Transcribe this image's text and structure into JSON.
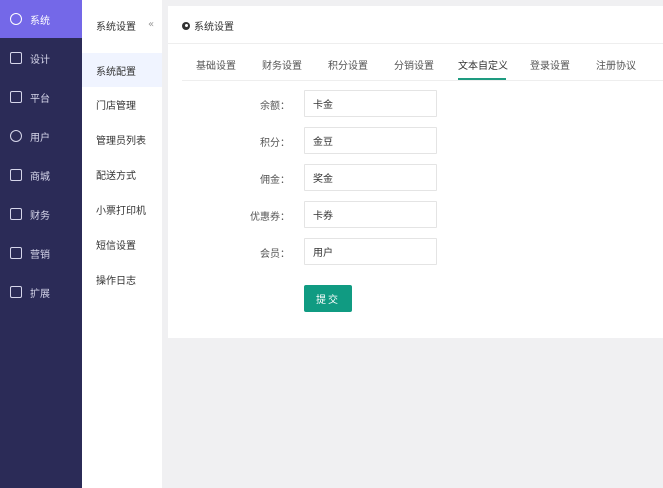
{
  "nav": {
    "items": [
      {
        "label": "系统",
        "icon": "settings-icon"
      },
      {
        "label": "设计",
        "icon": "monitor-icon"
      },
      {
        "label": "平台",
        "icon": "monitor-icon"
      },
      {
        "label": "用户",
        "icon": "user-icon"
      },
      {
        "label": "商城",
        "icon": "shop-icon"
      },
      {
        "label": "财务",
        "icon": "finance-icon"
      },
      {
        "label": "营销",
        "icon": "marketing-icon"
      },
      {
        "label": "扩展",
        "icon": "grid-icon"
      }
    ]
  },
  "sidebar": {
    "title": "系统设置",
    "collapse_glyph": "«",
    "items": [
      {
        "label": "系统配置"
      },
      {
        "label": "门店管理"
      },
      {
        "label": "管理员列表"
      },
      {
        "label": "配送方式"
      },
      {
        "label": "小票打印机"
      },
      {
        "label": "短信设置"
      },
      {
        "label": "操作日志"
      }
    ]
  },
  "main": {
    "title": "系统设置",
    "tabs": [
      {
        "label": "基础设置"
      },
      {
        "label": "财务设置"
      },
      {
        "label": "积分设置"
      },
      {
        "label": "分销设置"
      },
      {
        "label": "文本自定义"
      },
      {
        "label": "登录设置"
      },
      {
        "label": "注册协议"
      }
    ],
    "active_tab": "文本自定义",
    "form": {
      "fields": [
        {
          "label": "余额：",
          "value": "卡金"
        },
        {
          "label": "积分：",
          "value": "金豆"
        },
        {
          "label": "佣金：",
          "value": "奖金"
        },
        {
          "label": "优惠券：",
          "value": "卡券"
        },
        {
          "label": "会员：",
          "value": "用户"
        }
      ],
      "submit_label": "提交"
    }
  },
  "colors": {
    "nav_bg": "#2b2b57",
    "nav_active": "#7468e8",
    "accent": "#109b82"
  }
}
